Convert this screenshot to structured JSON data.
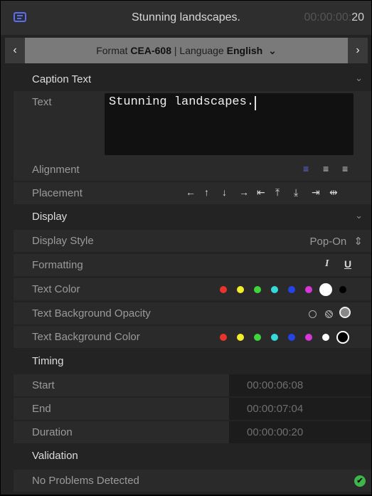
{
  "header": {
    "title": "Stunning landscapes.",
    "timecode_dim": "00:00:00:",
    "timecode_bright": "20"
  },
  "format_bar": {
    "prev_icon": "‹",
    "next_icon": "›",
    "format_prefix": "Format ",
    "format_value": "CEA-608",
    "separator": " | Language ",
    "language_value": "English",
    "dropdown_icon": "⌄"
  },
  "caption_text": {
    "section_label": "Caption Text",
    "text_label": "Text",
    "text_value": "Stunning landscapes.",
    "alignment_label": "Alignment",
    "placement_label": "Placement"
  },
  "display": {
    "section_label": "Display",
    "display_style_label": "Display Style",
    "display_style_value": "Pop-On",
    "formatting_label": "Formatting",
    "italic_label": "I",
    "underline_label": "U",
    "text_color_label": "Text Color",
    "text_colors": [
      "#e8342c",
      "#f2ee2c",
      "#3fd63a",
      "#36d8d8",
      "#2244e8",
      "#d836d8",
      "#ffffff",
      "#000000"
    ],
    "text_color_selected": 6,
    "text_bg_opacity_label": "Text Background Opacity",
    "text_bg_color_label": "Text Background Color",
    "text_bg_colors": [
      "#e8342c",
      "#f2ee2c",
      "#3fd63a",
      "#36d8d8",
      "#2244e8",
      "#d836d8",
      "#ffffff",
      "#000000"
    ],
    "text_bg_color_selected": 7
  },
  "timing": {
    "section_label": "Timing",
    "start_label": "Start",
    "start_value": "00:00:06:08",
    "end_label": "End",
    "end_value": "00:00:07:04",
    "duration_label": "Duration",
    "duration_value": "00:00:00:20"
  },
  "validation": {
    "section_label": "Validation",
    "status_text": "No Problems Detected"
  },
  "accent_color": "#5a6cf0"
}
